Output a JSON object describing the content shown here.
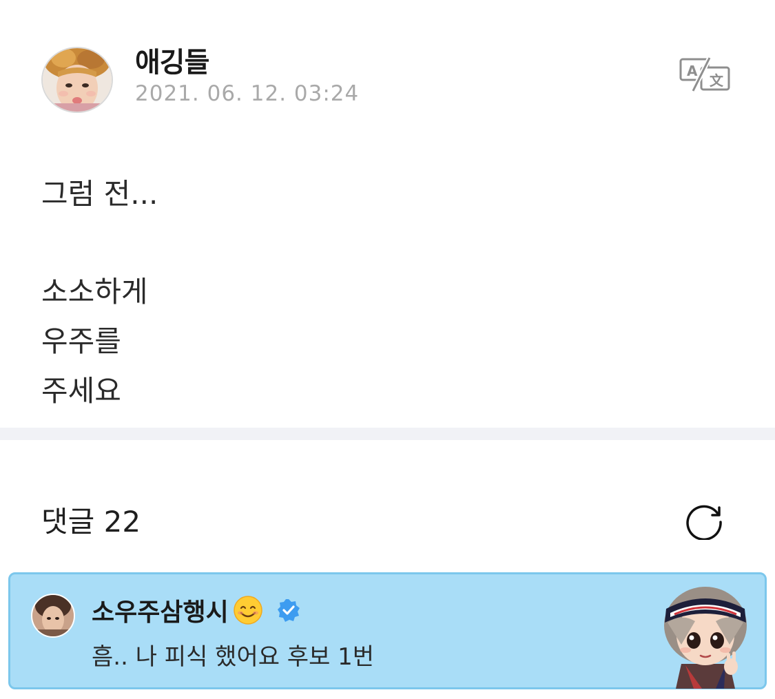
{
  "post": {
    "author": "애깅들",
    "date": "2021. 06. 12. 03:24",
    "body_lines": [
      "그럼 전...",
      "",
      "소소하게",
      "우주를",
      "주세요"
    ]
  },
  "icons": {
    "translate": "translate-icon",
    "refresh": "refresh-icon",
    "verified": "verified-badge-icon",
    "emoji": "smiling-face-emoji"
  },
  "comments": {
    "header": "댓글 22",
    "items": [
      {
        "author": "소우주삼행시",
        "text": "흠.. 나 피식 했어요 후보 1번"
      }
    ]
  },
  "colors": {
    "highlight_bg": "#a9ddf7",
    "highlight_border": "#7cc7ec",
    "verified": "#3d9cf0",
    "date": "#a9a9a9"
  }
}
